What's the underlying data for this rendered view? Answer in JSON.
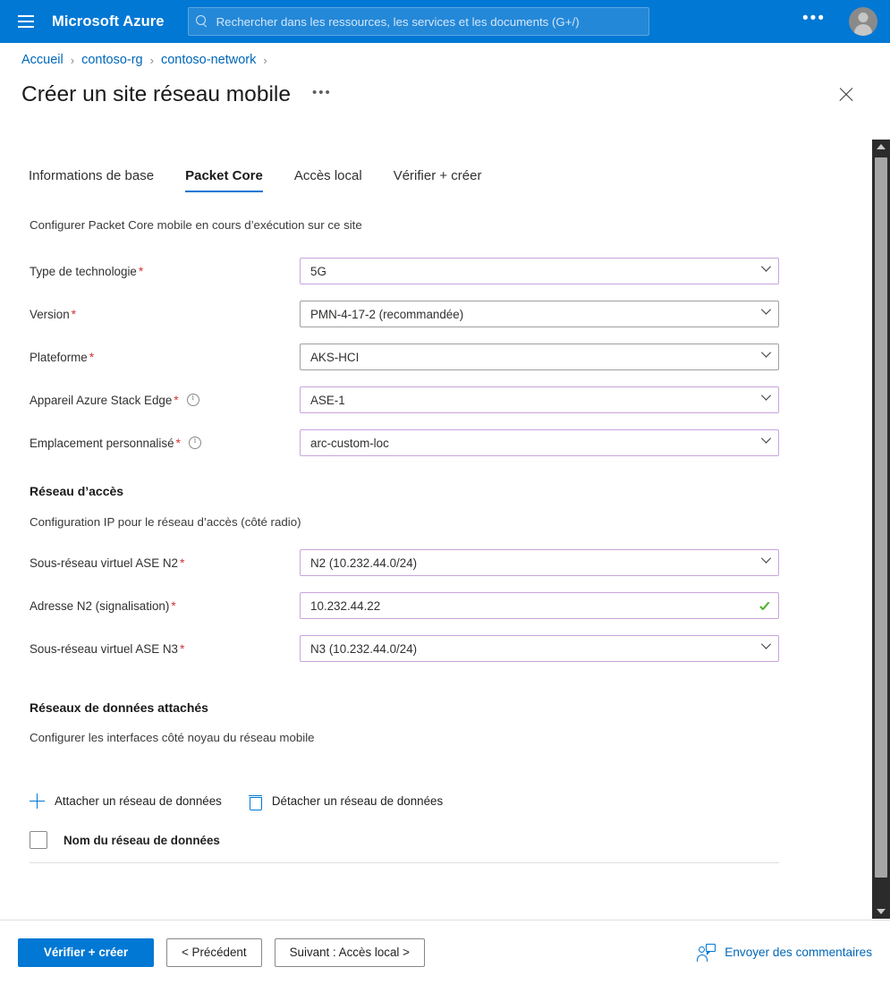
{
  "topbar": {
    "menu_icon": "hamburger-icon",
    "brand": "Microsoft Azure",
    "search_placeholder": "Rechercher dans les ressources, les services et les documents (G+/)",
    "search_icon": "search-icon",
    "more_label": "•••",
    "account_icon": "account-avatar-icon",
    "accent_color": "#0078d4"
  },
  "breadcrumb": {
    "items": [
      {
        "label": "Accueil"
      },
      {
        "label": "contoso-rg"
      },
      {
        "label": "contoso-network"
      }
    ],
    "separator": "›",
    "link_color": "#0067b8"
  },
  "header": {
    "title": "Créer un site réseau mobile",
    "more_label": "•••",
    "close_icon": "close-icon"
  },
  "tabs": [
    {
      "label": "Informations de base",
      "active": false
    },
    {
      "label": "Packet Core",
      "active": true
    },
    {
      "label": "Accès local",
      "active": false
    },
    {
      "label": "Vérifier + créer",
      "active": false
    }
  ],
  "main": {
    "intro": "Configurer Packet Core mobile en cours d’exécution sur ce site",
    "fields": [
      {
        "label": "Type de technologie",
        "required": true,
        "info": false,
        "value": "5G",
        "control": "dropdown",
        "modified": true
      },
      {
        "label": "Version",
        "required": true,
        "info": false,
        "value": "PMN-4-17-2 (recommandée)",
        "control": "dropdown",
        "modified": false
      },
      {
        "label": "Plateforme",
        "required": true,
        "info": false,
        "value": "AKS-HCI",
        "control": "dropdown",
        "modified": false
      },
      {
        "label": "Appareil Azure Stack Edge",
        "required": true,
        "info": true,
        "value": "ASE-1",
        "control": "dropdown",
        "modified": true
      },
      {
        "label": "Emplacement personnalisé",
        "required": true,
        "info": true,
        "value": "arc-custom-loc",
        "control": "dropdown",
        "modified": true
      }
    ],
    "access_network": {
      "heading": "Réseau d’accès",
      "description": "Configuration IP pour le réseau d’accès (côté radio)",
      "fields": [
        {
          "label": "Sous-réseau virtuel ASE N2",
          "required": true,
          "info": false,
          "value": "N2 (10.232.44.0/24)",
          "control": "dropdown",
          "modified": true
        },
        {
          "label": "Adresse N2 (signalisation)",
          "required": true,
          "info": false,
          "value": "10.232.44.22",
          "control": "validated-text",
          "modified": true
        },
        {
          "label": "Sous-réseau virtuel ASE N3",
          "required": true,
          "info": false,
          "value": "N3 (10.232.44.0/24)",
          "control": "dropdown",
          "modified": true
        }
      ]
    },
    "data_networks": {
      "heading": "Réseaux de données attachés",
      "description": "Configurer les interfaces côté noyau du réseau mobile",
      "attach_label": "Attacher un réseau de données",
      "attach_icon": "plus-icon",
      "detach_label": "Détacher un réseau de données",
      "detach_icon": "trash-icon",
      "column_header": "Nom du réseau de données",
      "select_all_checked": false,
      "rows": []
    }
  },
  "footer": {
    "primary_button": "Vérifier + créer",
    "previous_button": "< Précédent",
    "next_button": "Suivant :  Accès local  >",
    "feedback_label": "Envoyer des commentaires",
    "feedback_icon": "feedback-person-icon"
  },
  "scrollbar": {
    "up_icon": "scroll-up-arrow-icon",
    "down_icon": "scroll-down-arrow-icon"
  },
  "colors": {
    "azure_blue": "#0078d4",
    "link_blue": "#0067b8",
    "required_red": "#d13438",
    "modified_border": "#c9a3dd",
    "valid_green": "#4caf28"
  }
}
